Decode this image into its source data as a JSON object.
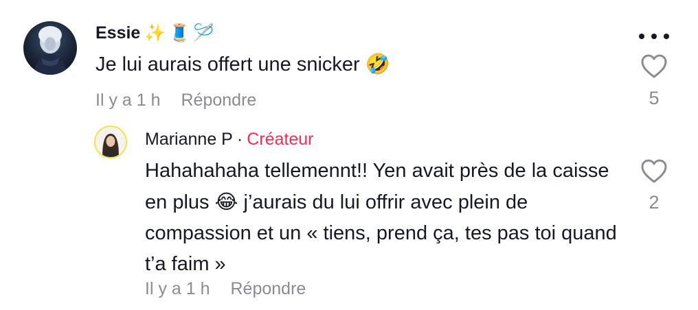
{
  "comment": {
    "author": "Essie",
    "author_emojis": [
      "✨",
      "🧵",
      "🪡"
    ],
    "text": "Je lui aurais offert une snicker",
    "text_emoji": "🤣",
    "time": "Il y a 1 h",
    "reply_label": "Répondre",
    "like_count": "5",
    "icons": {
      "avatar": "profile-avatar",
      "more": "more-icon",
      "like": "heart-icon"
    }
  },
  "reply": {
    "author": "Marianne P",
    "separator": "·",
    "badge": "Créateur",
    "text_part1": "Hahahahaha tellemennt!! Yen avait près de la caisse en plus",
    "text_emoji": "😂",
    "text_part2": "j’aurais du lui offrir avec plein de compassion et un « tiens, prend ça, tes pas toi quand t’a faim »",
    "time": "Il y a 1 h",
    "reply_label": "Répondre",
    "like_count": "2",
    "icons": {
      "avatar": "profile-avatar",
      "like": "heart-icon"
    }
  },
  "colors": {
    "text": "#161823",
    "secondary": "#8a8b91",
    "creator_badge": "#fe2c55",
    "avatar_ring": "#f3e34a"
  }
}
